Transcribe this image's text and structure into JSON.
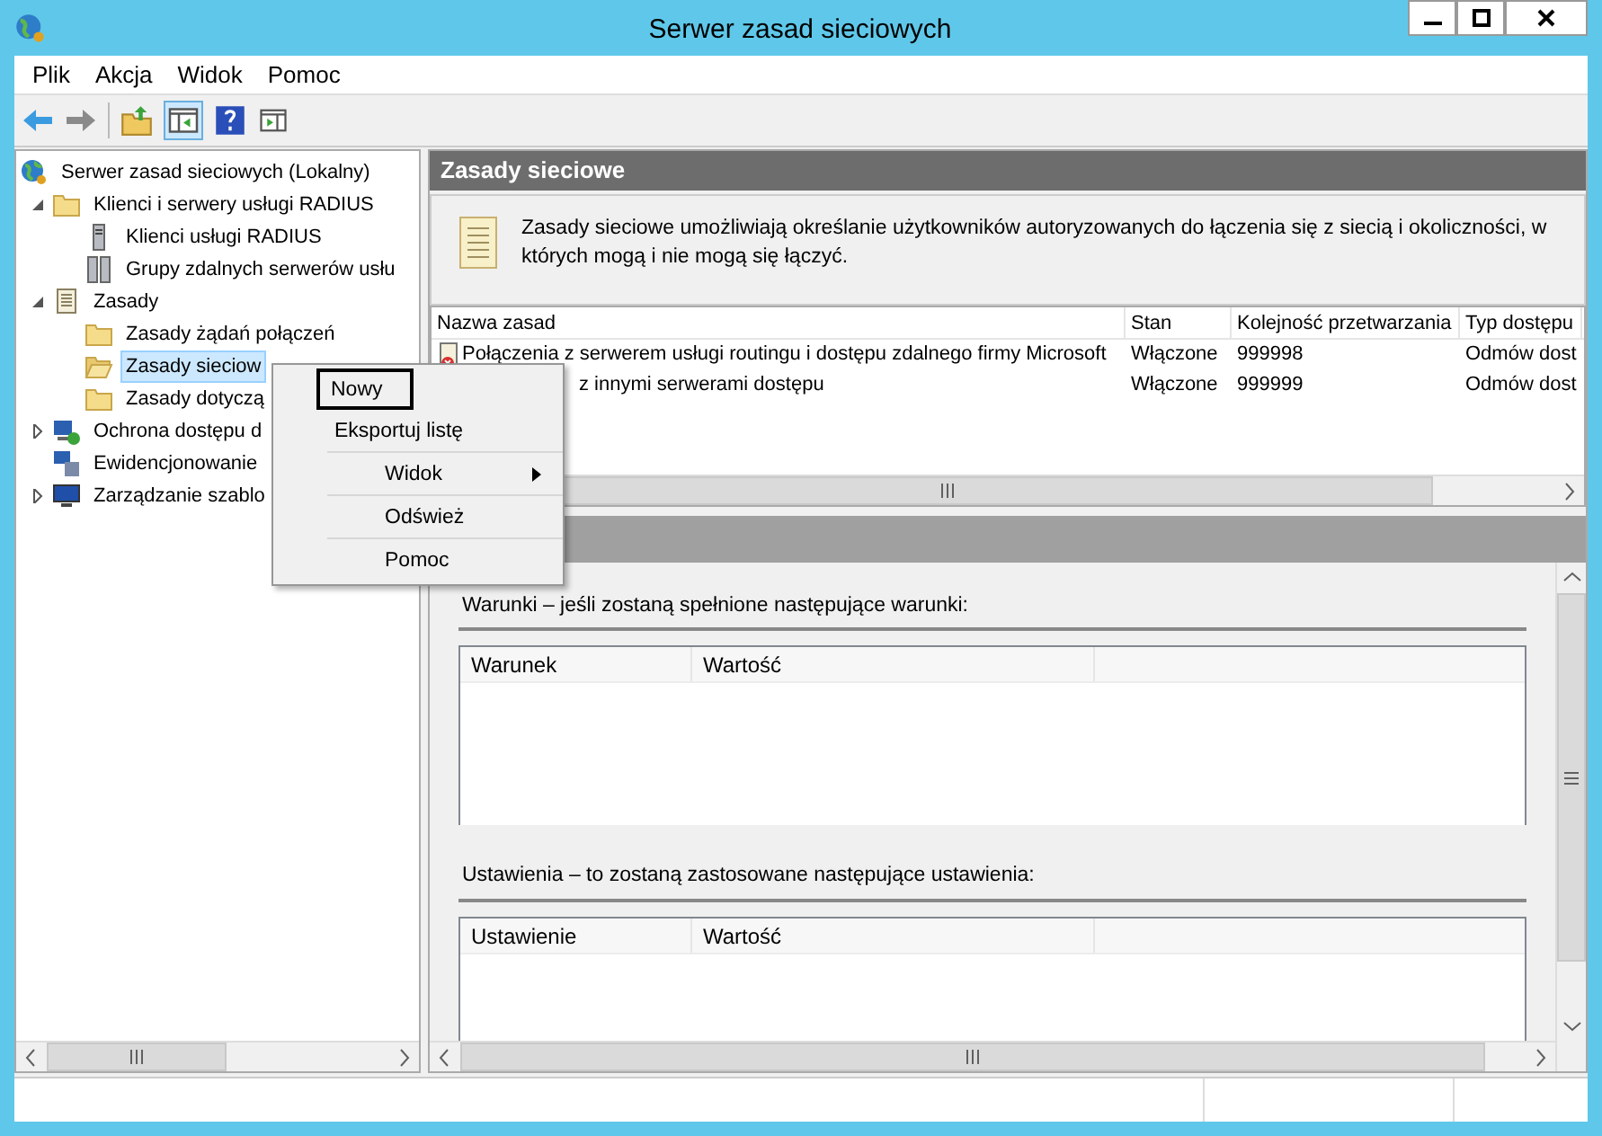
{
  "window": {
    "title": "Serwer zasad sieciowych"
  },
  "menu": [
    "Plik",
    "Akcja",
    "Widok",
    "Pomoc"
  ],
  "tree": [
    {
      "label": "Serwer zasad sieciowych (Lokalny)",
      "kind": "globe",
      "selected": false,
      "children": [
        {
          "label": "Klienci i serwery usługi RADIUS",
          "kind": "folder",
          "expanded": true,
          "selected": false,
          "children": [
            {
              "label": "Klienci usługi RADIUS",
              "kind": "server",
              "selected": false
            },
            {
              "label": "Grupy zdalnych serwerów usłu",
              "kind": "servers",
              "selected": false
            }
          ]
        },
        {
          "label": "Zasady",
          "kind": "scroll",
          "expanded": true,
          "selected": false,
          "children": [
            {
              "label": "Zasady żądań połączeń",
              "kind": "folder",
              "selected": false
            },
            {
              "label": "Zasady sieciow",
              "kind": "folder",
              "selected": true
            },
            {
              "label": "Zasady dotyczą",
              "kind": "folder",
              "selected": false
            }
          ]
        },
        {
          "label": "Ochrona dostępu d",
          "kind": "nap",
          "expanded": false,
          "selected": false
        },
        {
          "label": "Ewidencjonowanie",
          "kind": "accounting",
          "selected": false
        },
        {
          "label": "Zarządzanie szablo",
          "kind": "monitor",
          "expanded": false,
          "selected": false
        }
      ]
    }
  ],
  "context_menu": [
    [
      {
        "label": "Nowy",
        "selected": true,
        "submenu": false
      },
      {
        "label": "Eksportuj listę",
        "selected": false,
        "submenu": false
      }
    ],
    [
      {
        "label": "Widok",
        "selected": false,
        "submenu": true
      }
    ],
    [
      {
        "label": "Odśwież",
        "selected": false,
        "submenu": false
      }
    ],
    [
      {
        "label": "Pomoc",
        "selected": false,
        "submenu": false
      }
    ]
  ],
  "panel": {
    "title": "Zasady sieciowe",
    "description": "Zasady sieciowe umożliwiają określanie użytkowników autoryzowanych do łączenia się z siecią i okoliczności, w których mogą i nie mogą się łączyć."
  },
  "policies": {
    "columns": [
      "Nazwa zasad",
      "Stan",
      "Kolejność przetwarzania",
      "Typ dostępu"
    ],
    "rows": [
      {
        "kind": "denied",
        "cells": [
          "Połączenia z serwerem usługi routingu i dostępu zdalnego firmy Microsoft",
          "Włączone",
          "999998",
          "Odmów dost"
        ]
      },
      {
        "kind": "covered",
        "cells": [
          "z innymi serwerami dostępu",
          "Włączone",
          "999999",
          "Odmów dost"
        ]
      }
    ]
  },
  "conditions": {
    "heading": "Warunki – jeśli zostaną spełnione następujące warunki:",
    "columns": [
      "Warunek",
      "Wartość"
    ]
  },
  "settings": {
    "heading": "Ustawienia – to zostaną zastosowane następujące ustawienia:",
    "columns": [
      "Ustawienie",
      "Wartość"
    ]
  }
}
